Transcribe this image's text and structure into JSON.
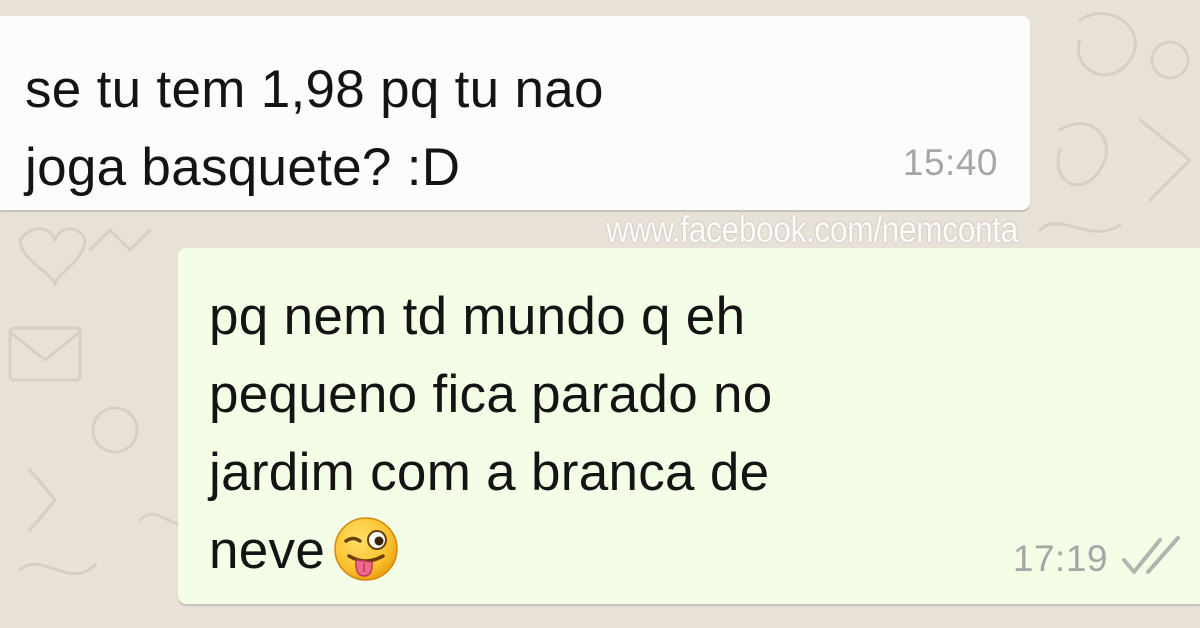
{
  "conversation": {
    "incoming": {
      "lines": [
        "se tu tem 1,98 pq tu nao",
        "joga basquete? :D"
      ],
      "time": "15:40"
    },
    "outgoing": {
      "lines": [
        "pq nem td mundo q eh",
        "pequeno fica parado no",
        "jardim com a branca de",
        "neve"
      ],
      "emoji": "winking-face-with-tongue-emoji",
      "time": "17:19",
      "status_icon": "read-double-check-icon"
    }
  },
  "watermark": {
    "text": "www.facebook.com/nemconta"
  },
  "colors": {
    "wallpaper": "#e7e1d8",
    "incoming_bubble": "#fcfcfa",
    "outgoing_bubble": "#f4fde6",
    "message_text": "#141414",
    "timestamp": "#a6a6a6"
  }
}
